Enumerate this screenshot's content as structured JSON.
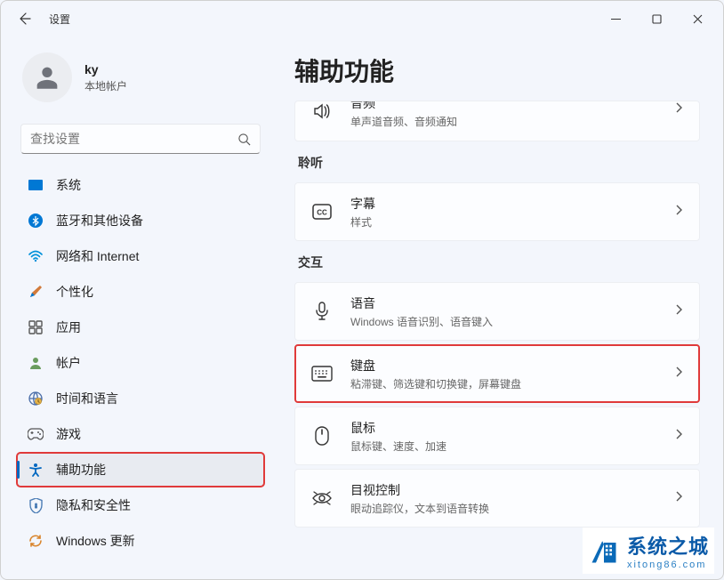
{
  "window": {
    "app_title": "设置"
  },
  "user": {
    "name": "ky",
    "subtitle": "本地帐户"
  },
  "search": {
    "placeholder": "查找设置"
  },
  "sidebar": {
    "items": [
      {
        "id": "system",
        "label": "系统"
      },
      {
        "id": "bluetooth",
        "label": "蓝牙和其他设备"
      },
      {
        "id": "network",
        "label": "网络和 Internet"
      },
      {
        "id": "personalization",
        "label": "个性化"
      },
      {
        "id": "apps",
        "label": "应用"
      },
      {
        "id": "accounts",
        "label": "帐户"
      },
      {
        "id": "time-language",
        "label": "时间和语言"
      },
      {
        "id": "gaming",
        "label": "游戏"
      },
      {
        "id": "accessibility",
        "label": "辅助功能"
      },
      {
        "id": "privacy",
        "label": "隐私和安全性"
      },
      {
        "id": "update",
        "label": "Windows 更新"
      }
    ]
  },
  "page": {
    "title": "辅助功能",
    "sections": {
      "hearing_label": "聆听",
      "interaction_label": "交互"
    },
    "cards": {
      "audio": {
        "title": "音频",
        "subtitle": "单声道音频、音频通知"
      },
      "captions": {
        "title": "字幕",
        "subtitle": "样式"
      },
      "speech": {
        "title": "语音",
        "subtitle": "Windows 语音识别、语音键入"
      },
      "keyboard": {
        "title": "键盘",
        "subtitle": "粘滞键、筛选键和切换键，屏幕键盘"
      },
      "mouse": {
        "title": "鼠标",
        "subtitle": "鼠标键、速度、加速"
      },
      "eye": {
        "title": "目视控制",
        "subtitle": "眼动追踪仪，文本到语音转换"
      }
    }
  },
  "watermark": {
    "text": "系统之城",
    "sub": "xitong86.com"
  }
}
